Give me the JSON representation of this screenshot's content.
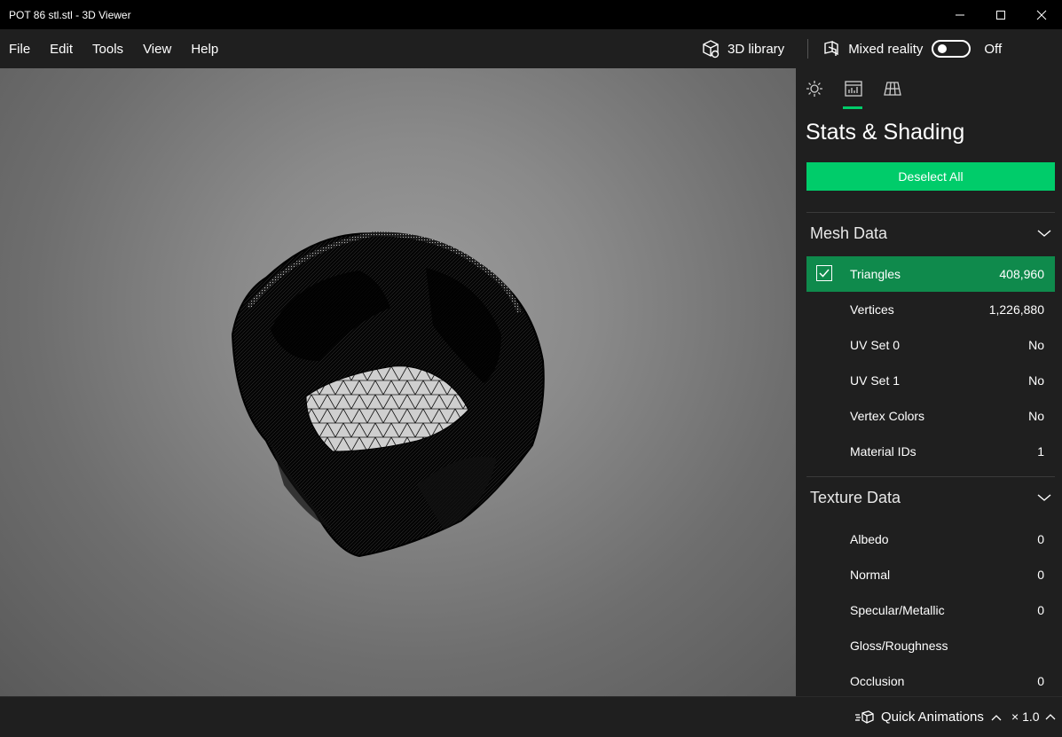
{
  "window": {
    "title": "POT 86 stl.stl - 3D Viewer"
  },
  "menu": {
    "items": [
      "File",
      "Edit",
      "Tools",
      "View",
      "Help"
    ]
  },
  "toolbar": {
    "library_label": "3D library",
    "mixed_reality_label": "Mixed reality",
    "toggle_state": "Off"
  },
  "panel": {
    "title": "Stats & Shading",
    "deselect_label": "Deselect All",
    "mesh_section": "Mesh Data",
    "mesh_rows": [
      {
        "label": "Triangles",
        "value": "408,960"
      },
      {
        "label": "Vertices",
        "value": "1,226,880"
      },
      {
        "label": "UV Set 0",
        "value": "No"
      },
      {
        "label": "UV Set 1",
        "value": "No"
      },
      {
        "label": "Vertex Colors",
        "value": "No"
      },
      {
        "label": "Material IDs",
        "value": "1"
      }
    ],
    "texture_section": "Texture Data",
    "texture_rows": [
      {
        "label": "Albedo",
        "value": "0"
      },
      {
        "label": "Normal",
        "value": "0"
      },
      {
        "label": "Specular/Metallic",
        "value": "0"
      },
      {
        "label": "Gloss/Roughness",
        "value": ""
      },
      {
        "label": "Occlusion",
        "value": "0"
      }
    ]
  },
  "status": {
    "animations_label": "Quick Animations",
    "speed": "× 1.0"
  },
  "colors": {
    "accent": "#00cc6a",
    "selected_row": "#0f8a4c"
  }
}
